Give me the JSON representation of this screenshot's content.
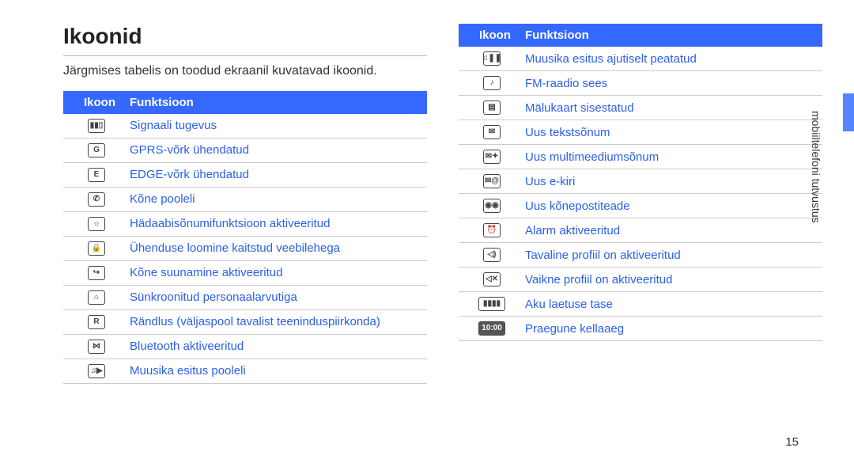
{
  "title": "Ikoonid",
  "intro": "Järgmises tabelis on toodud ekraanil kuvatavad ikoonid.",
  "header_icon": "Ikoon",
  "header_fn": "Funktsioon",
  "side_text": "mobiiltelefoni tutvustus",
  "page_number": "15",
  "left_rows": [
    {
      "icon": "signal-strength-icon",
      "glyph": "▮▮▯",
      "fn": "Signaali tugevus"
    },
    {
      "icon": "gprs-icon",
      "glyph": "G",
      "fn": "GPRS-võrk ühendatud"
    },
    {
      "icon": "edge-icon",
      "glyph": "E",
      "fn": "EDGE-võrk ühendatud"
    },
    {
      "icon": "call-in-progress-icon",
      "glyph": "✆",
      "fn": "Kõne pooleli"
    },
    {
      "icon": "sos-icon",
      "glyph": "☼",
      "fn": "Hädaabisõnumifunktsioon aktiveeritud"
    },
    {
      "icon": "secure-web-icon",
      "glyph": "🔒",
      "fn": "Ühenduse loomine kaitstud veebilehega"
    },
    {
      "icon": "call-forward-icon",
      "glyph": "↪",
      "fn": "Kõne suunamine aktiveeritud"
    },
    {
      "icon": "sync-pc-icon",
      "glyph": "⌂",
      "fn": "Sünkroonitud personaalarvutiga"
    },
    {
      "icon": "roaming-icon",
      "glyph": "R",
      "fn": "Rändlus (väljaspool tavalist teeninduspiirkonda)"
    },
    {
      "icon": "bluetooth-icon",
      "glyph": "⋈",
      "fn": "Bluetooth aktiveeritud"
    },
    {
      "icon": "music-play-icon",
      "glyph": "♫▶",
      "fn": "Muusika esitus pooleli"
    }
  ],
  "right_rows": [
    {
      "icon": "music-pause-icon",
      "glyph": "♫❚❚",
      "fn": "Muusika esitus ajutiselt peatatud"
    },
    {
      "icon": "fm-radio-icon",
      "glyph": "♪",
      "fn": "FM-raadio sees"
    },
    {
      "icon": "memory-card-icon",
      "glyph": "▤",
      "fn": "Mälukaart sisestatud"
    },
    {
      "icon": "new-sms-icon",
      "glyph": "✉",
      "fn": "Uus tekstsõnum"
    },
    {
      "icon": "new-mms-icon",
      "glyph": "✉✦",
      "fn": "Uus multimeediumsõnum"
    },
    {
      "icon": "new-email-icon",
      "glyph": "✉@",
      "fn": "Uus e-kiri"
    },
    {
      "icon": "voicemail-icon",
      "glyph": "◉◉",
      "fn": "Uus kõnepostiteade"
    },
    {
      "icon": "alarm-icon",
      "glyph": "⏰",
      "fn": "Alarm aktiveeritud"
    },
    {
      "icon": "normal-profile-icon",
      "glyph": "◁)",
      "fn": "Tavaline profiil on aktiveeritud"
    },
    {
      "icon": "silent-profile-icon",
      "glyph": "◁✕",
      "fn": "Vaikne profiil on aktiveeritud"
    },
    {
      "icon": "battery-icon",
      "glyph": "▮▮▮▮",
      "fn": "Aku laetuse tase",
      "wide": true
    },
    {
      "icon": "clock-icon",
      "glyph": "10:00",
      "fn": "Praegune kellaaeg",
      "wide": true,
      "filled": true
    }
  ]
}
